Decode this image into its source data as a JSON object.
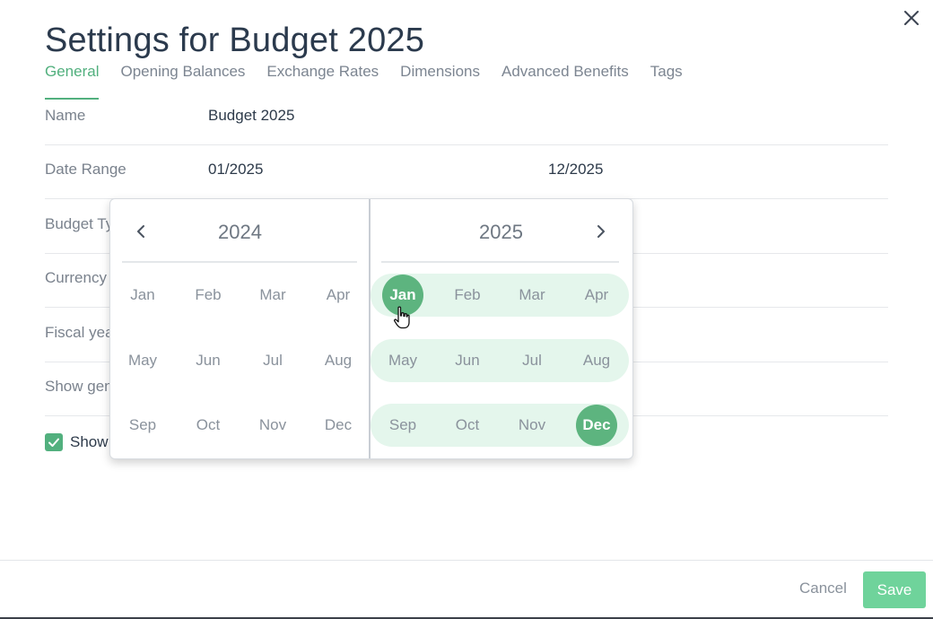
{
  "dialog": {
    "title": "Settings for Budget 2025",
    "tabs": [
      {
        "label": "General",
        "active": true
      },
      {
        "label": "Opening Balances",
        "active": false
      },
      {
        "label": "Exchange Rates",
        "active": false
      },
      {
        "label": "Dimensions",
        "active": false
      },
      {
        "label": "Advanced Benefits",
        "active": false
      },
      {
        "label": "Tags",
        "active": false
      }
    ],
    "close_icon": "close-icon"
  },
  "form": {
    "name": {
      "label": "Name",
      "value": "Budget 2025"
    },
    "date_range": {
      "label": "Date Range",
      "start": "01/2025",
      "end": "12/2025"
    },
    "budget_type": {
      "label": "Budget Ty"
    },
    "currency": {
      "label": "Currency"
    },
    "fiscal_year": {
      "label": "Fiscal yea"
    },
    "show_gen": {
      "label": "Show gen"
    },
    "show_checkbox": {
      "label": "Show",
      "checked": true
    }
  },
  "picker": {
    "prev_icon": "chevron-left-icon",
    "next_icon": "chevron-right-icon",
    "left_year": "2024",
    "right_year": "2025",
    "months": [
      "Jan",
      "Feb",
      "Mar",
      "Apr",
      "May",
      "Jun",
      "Jul",
      "Aug",
      "Sep",
      "Oct",
      "Nov",
      "Dec"
    ],
    "selected_start": "Jan 2025",
    "selected_end": "Dec 2025"
  },
  "footer": {
    "cancel_label": "Cancel",
    "save_label": "Save"
  },
  "colors": {
    "accent": "#52b07e",
    "range_fill": "#e4f6ec",
    "save_button": "#6fd39b"
  }
}
